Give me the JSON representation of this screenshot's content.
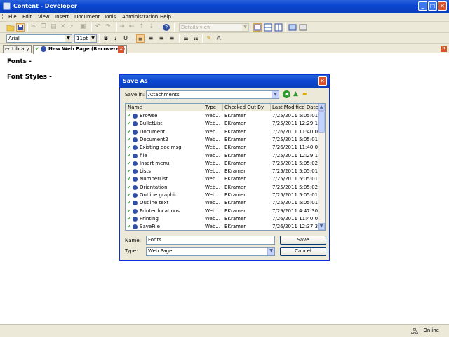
{
  "window": {
    "title": "Content - Developer"
  },
  "menu": [
    "File",
    "Edit",
    "View",
    "Insert",
    "Document",
    "Tools",
    "Administration",
    "Help"
  ],
  "toolbar": {
    "view_combo": "Details view"
  },
  "format": {
    "font": "Arial",
    "size": "11pt",
    "bold": "B",
    "italic": "I",
    "underline": "U"
  },
  "tabs": [
    {
      "label": "Library"
    },
    {
      "label": "New Web Page (Recovered)"
    }
  ],
  "editor": {
    "line1": "Fonts -",
    "line2": "Font Styles -"
  },
  "dialog": {
    "title": "Save As",
    "save_in_label": "Save in:",
    "save_in_value": "Attachments",
    "columns": [
      "Name",
      "Type",
      "Checked Out By",
      "Last Modified Date"
    ],
    "files": [
      {
        "name": "Browse",
        "type": "Web...",
        "by": "EKramer",
        "date": "7/25/2011 5:05:01 ..."
      },
      {
        "name": "BulletList",
        "type": "Web...",
        "by": "EKramer",
        "date": "7/25/2011 12:29:1..."
      },
      {
        "name": "Document",
        "type": "Web...",
        "by": "EKramer",
        "date": "7/26/2011 11:40:0..."
      },
      {
        "name": "Document2",
        "type": "Web...",
        "by": "EKramer",
        "date": "7/25/2011 5:05:01 ..."
      },
      {
        "name": "Existing doc msg",
        "type": "Web...",
        "by": "EKramer",
        "date": "7/26/2011 11:40:0..."
      },
      {
        "name": "file",
        "type": "Web...",
        "by": "EKramer",
        "date": "7/25/2011 12:29:1..."
      },
      {
        "name": "Insert menu",
        "type": "Web...",
        "by": "EKramer",
        "date": "7/25/2011 5:05:02 ..."
      },
      {
        "name": "Lists",
        "type": "Web...",
        "by": "EKramer",
        "date": "7/25/2011 5:05:01 ..."
      },
      {
        "name": "NumberList",
        "type": "Web...",
        "by": "EKramer",
        "date": "7/25/2011 5:05:01 ..."
      },
      {
        "name": "Orientation",
        "type": "Web...",
        "by": "EKramer",
        "date": "7/25/2011 5:05:02 ..."
      },
      {
        "name": "Outline graphic",
        "type": "Web...",
        "by": "EKramer",
        "date": "7/25/2011 5:05:01 ..."
      },
      {
        "name": "Outline text",
        "type": "Web...",
        "by": "EKramer",
        "date": "7/25/2011 5:05:01 ..."
      },
      {
        "name": "Printer locations",
        "type": "Web...",
        "by": "EKramer",
        "date": "7/29/2011 4:47:30 ..."
      },
      {
        "name": "Printing",
        "type": "Web...",
        "by": "EKramer",
        "date": "7/26/2011 11:40:0..."
      },
      {
        "name": "SaveFile",
        "type": "Web...",
        "by": "EKramer",
        "date": "7/26/2011 12:37:3..."
      }
    ],
    "name_label": "Name:",
    "name_value": "Fonts",
    "type_label": "Type:",
    "type_value": "Web Page",
    "save_button": "Save",
    "cancel_button": "Cancel"
  },
  "status": {
    "text": "Online"
  },
  "colors": {
    "titlebar": "#0a46d0",
    "dialog_border": "#0831d9",
    "check": "#2e9b2e"
  }
}
